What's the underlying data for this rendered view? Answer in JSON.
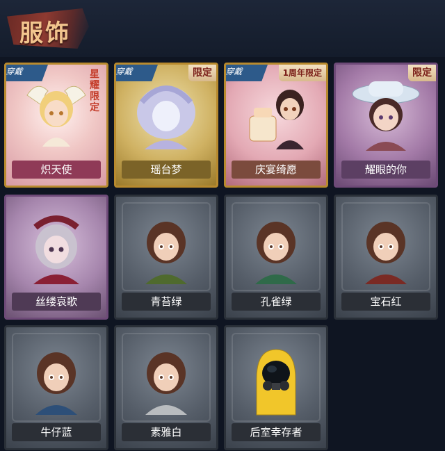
{
  "header": {
    "title": "服饰"
  },
  "badges": {
    "wear": "穿戴",
    "limited": "限定",
    "anniversary_limited": "1周年限定",
    "star": "星耀限定"
  },
  "costumes": [
    {
      "name": "炽天使",
      "frame": "pink-gold",
      "worn": true,
      "badge": "star"
    },
    {
      "name": "瑶台梦",
      "frame": "gold",
      "worn": true,
      "badge": "limited"
    },
    {
      "name": "庆宴绮愿",
      "frame": "gold",
      "worn": true,
      "badge": "anniversary_limited"
    },
    {
      "name": "耀眼的你",
      "frame": "purple",
      "worn": false,
      "badge": "limited"
    },
    {
      "name": "丝缕哀歌",
      "frame": "purple",
      "worn": false,
      "badge": ""
    },
    {
      "name": "青苔绿",
      "frame": "gray",
      "worn": false,
      "badge": ""
    },
    {
      "name": "孔雀绿",
      "frame": "gray",
      "worn": false,
      "badge": ""
    },
    {
      "name": "宝石红",
      "frame": "gray",
      "worn": false,
      "badge": ""
    },
    {
      "name": "牛仔蓝",
      "frame": "gray",
      "worn": false,
      "badge": ""
    },
    {
      "name": "素雅白",
      "frame": "gray",
      "worn": false,
      "badge": ""
    },
    {
      "name": "后室幸存者",
      "frame": "gray",
      "worn": false,
      "badge": ""
    }
  ]
}
